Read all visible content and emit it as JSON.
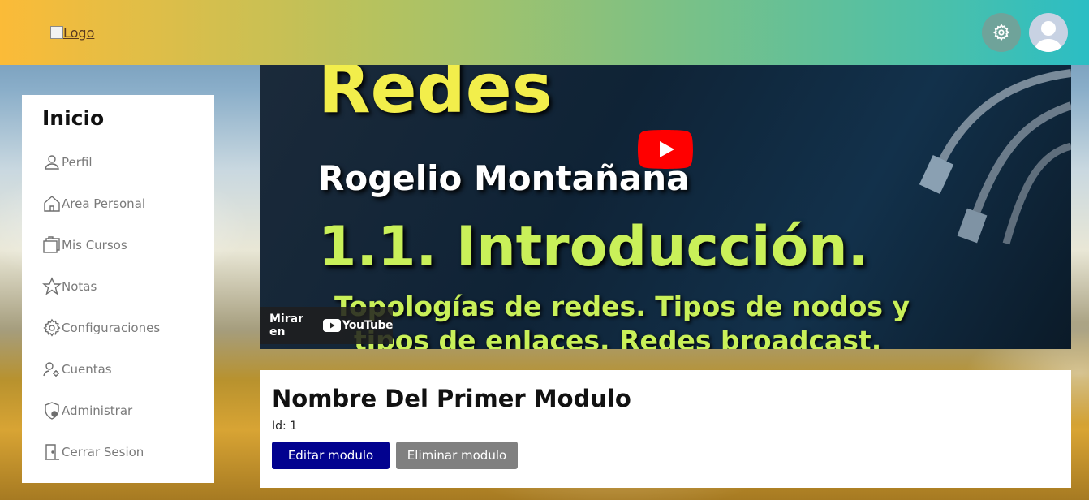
{
  "header": {
    "logo_alt": "Logo",
    "settings_icon": "gear-icon",
    "avatar_icon": "user-avatar"
  },
  "sidebar": {
    "title": "Inicio",
    "items": [
      {
        "label": "Perfil",
        "icon": "user-icon"
      },
      {
        "label": "Area Personal",
        "icon": "home-icon"
      },
      {
        "label": "Mis Cursos",
        "icon": "courses-icon"
      },
      {
        "label": "Notas",
        "icon": "star-icon"
      },
      {
        "label": "Configuraciones",
        "icon": "gear-icon"
      },
      {
        "label": "Cuentas",
        "icon": "users-gear-icon"
      },
      {
        "label": "Administrar",
        "icon": "shield-icon"
      },
      {
        "label": "Cerrar Sesion",
        "icon": "door-icon"
      }
    ]
  },
  "video": {
    "title_line": "Redes",
    "author": "Rogelio Montañana",
    "chapter": "1.1. Introducción.",
    "subtitle_1": "Topologías de redes. Tipos de nodos y",
    "subtitle_2": "tipos de enlaces. Redes broadcast.",
    "watch_on": "Mirar en",
    "youtube": "YouTube"
  },
  "module": {
    "name": "Nombre Del Primer Modulo",
    "id_text": "Id: 1",
    "edit_label": "Editar modulo",
    "delete_label": "Eliminar modulo"
  },
  "colors": {
    "edit_button": "#02028f",
    "delete_button": "#808080",
    "header_gradient_start": "#fbbb38",
    "header_gradient_end": "#2bbec4"
  }
}
